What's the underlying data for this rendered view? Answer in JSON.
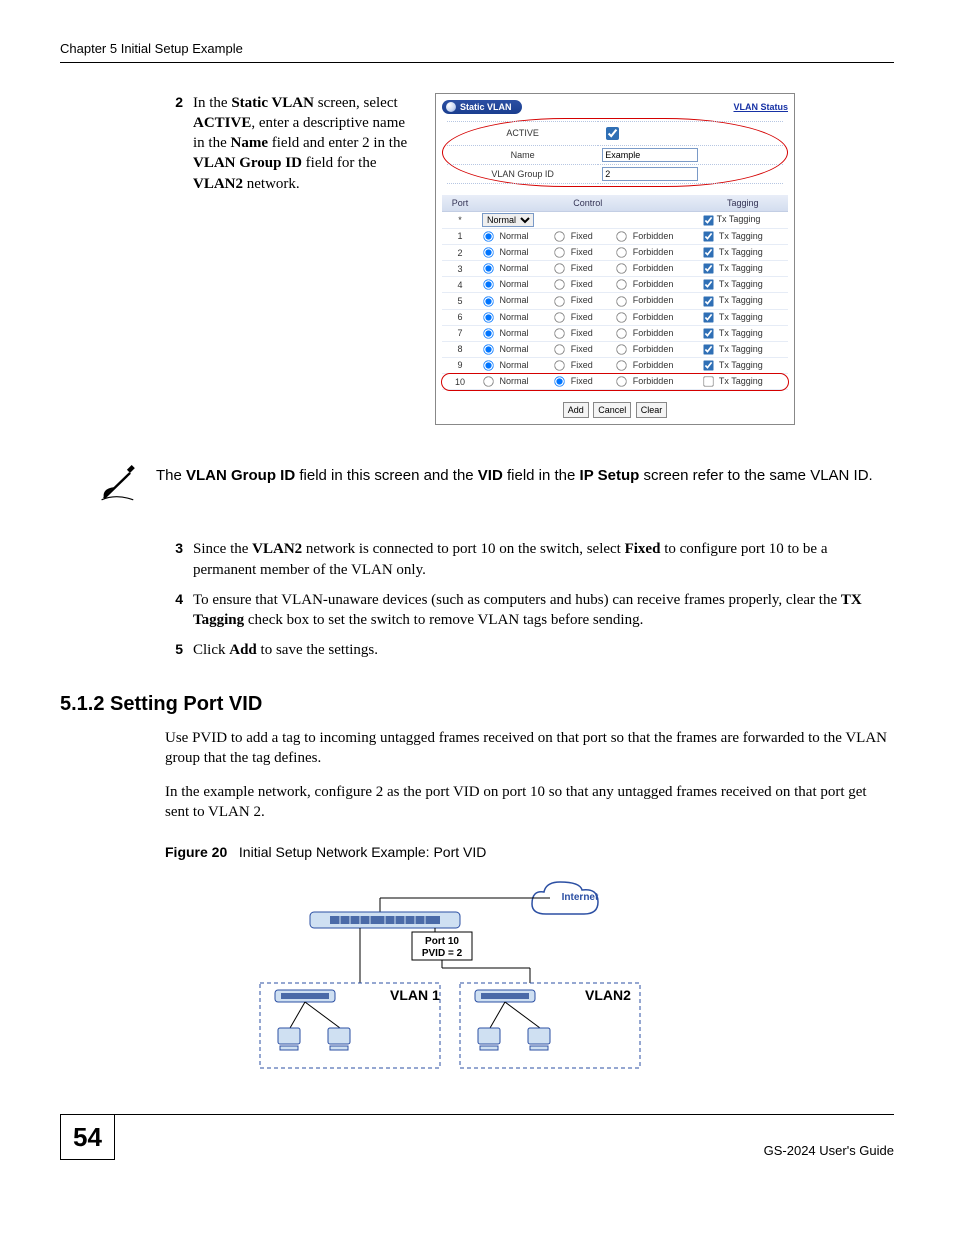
{
  "header": {
    "chapter": "Chapter 5 Initial Setup Example"
  },
  "step2": {
    "num": "2",
    "text_parts": {
      "p1": "In the ",
      "b1": "Static VLAN",
      "p2": " screen, select ",
      "b2": "ACTIVE",
      "p3": ", enter a descriptive name in the ",
      "b3": "Name",
      "p4": " field and enter 2 in the ",
      "b4": "VLAN Group ID",
      "p5": " field for the ",
      "b5": "VLAN2",
      "p6": " network."
    }
  },
  "screenshot": {
    "title": "Static VLAN",
    "status_link": "VLAN Status",
    "labels": {
      "active": "ACTIVE",
      "name": "Name",
      "group_id": "VLAN Group ID"
    },
    "values": {
      "name": "Example",
      "group_id": "2"
    },
    "columns": {
      "port": "Port",
      "control": "Control",
      "tagging": "Tagging"
    },
    "options": {
      "normal": "Normal",
      "fixed": "Fixed",
      "forbidden": "Forbidden",
      "tx": "Tx Tagging"
    },
    "star_row": {
      "port": "*",
      "select": "Normal"
    },
    "rows": [
      {
        "port": "1",
        "sel": "normal",
        "tx": true
      },
      {
        "port": "2",
        "sel": "normal",
        "tx": true
      },
      {
        "port": "3",
        "sel": "normal",
        "tx": true
      },
      {
        "port": "4",
        "sel": "normal",
        "tx": true
      },
      {
        "port": "5",
        "sel": "normal",
        "tx": true
      },
      {
        "port": "6",
        "sel": "normal",
        "tx": true
      },
      {
        "port": "7",
        "sel": "normal",
        "tx": true
      },
      {
        "port": "8",
        "sel": "normal",
        "tx": true
      },
      {
        "port": "9",
        "sel": "normal",
        "tx": true
      },
      {
        "port": "10",
        "sel": "fixed",
        "tx": false
      }
    ],
    "buttons": {
      "add": "Add",
      "cancel": "Cancel",
      "clear": "Clear"
    }
  },
  "note": {
    "p1": "The ",
    "b1": "VLAN Group ID",
    "p2": " field in this screen and the ",
    "b2": "VID",
    "p3": " field in the ",
    "b3": "IP Setup",
    "p4": " screen refer to the same VLAN ID."
  },
  "step3": {
    "num": "3",
    "p1": "Since the ",
    "b1": "VLAN2",
    "p2": " network is connected to port 10 on the switch, select ",
    "b2": "Fixed",
    "p3": " to configure port 10 to be a permanent member of the VLAN only."
  },
  "step4": {
    "num": "4",
    "p1": "To ensure that VLAN-unaware devices (such as computers and hubs) can receive frames properly, clear the ",
    "b1": "TX Tagging",
    "p2": " check box to set the switch to remove VLAN tags before sending."
  },
  "step5": {
    "num": "5",
    "p1": "Click ",
    "b1": "Add",
    "p2": " to save the settings."
  },
  "section": {
    "num_title": "5.1.2  Setting Port VID"
  },
  "para1": "Use PVID to add a tag to incoming untagged frames received on that port so that the frames are forwarded to the VLAN group that the tag defines.",
  "para2": "In the example network, configure 2 as the port VID on port 10 so that any untagged frames received on that port get sent to VLAN 2.",
  "fig": {
    "label": "Figure 20",
    "caption": "Initial Setup Network Example: Port VID"
  },
  "diagram": {
    "internet": "Internet",
    "port_line1": "Port 10",
    "port_line2": "PVID = 2",
    "vlan1": "VLAN 1",
    "vlan2": "VLAN2"
  },
  "footer": {
    "page": "54",
    "guide": "GS-2024 User's Guide"
  }
}
